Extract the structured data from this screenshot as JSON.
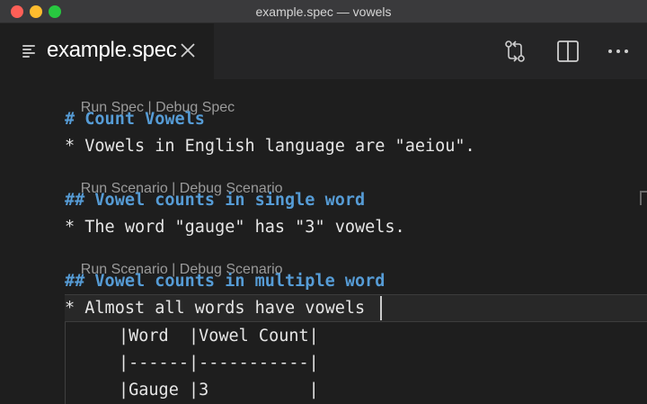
{
  "window": {
    "title": "example.spec — vowels"
  },
  "tab": {
    "label": "example.spec"
  },
  "editor": {
    "lens_spec": {
      "run": "Run Spec",
      "sep": " | ",
      "debug": "Debug Spec"
    },
    "lens_scenario_1": {
      "run": "Run Scenario",
      "sep": " | ",
      "debug": "Debug Scenario"
    },
    "lens_scenario_2": {
      "run": "Run Scenario",
      "sep": " | ",
      "debug": "Debug Scenario"
    },
    "heading_spec": "# Count Vowels",
    "step_spec": "* Vowels in English language are \"aeiou\".",
    "heading_scenario_1": "## Vowel counts in single word",
    "step_scenario_1": "* The word \"gauge\" has \"3\" vowels.",
    "heading_scenario_2": "## Vowel counts in multiple word",
    "step_scenario_2": "* Almost all words have vowels",
    "table": [
      "|Word  |Vowel Count|",
      "|------|-----------|",
      "|Gauge |3          |"
    ]
  },
  "colors": {
    "heading": "#569cd6",
    "text": "#e6e6e6",
    "lens": "#9a9a9a",
    "background": "#1e1e1e"
  },
  "icons": {
    "file_icon": "lines-icon",
    "close": "close-icon",
    "compare": "compare-changes-icon",
    "split": "split-editor-icon",
    "more": "more-actions-icon"
  }
}
